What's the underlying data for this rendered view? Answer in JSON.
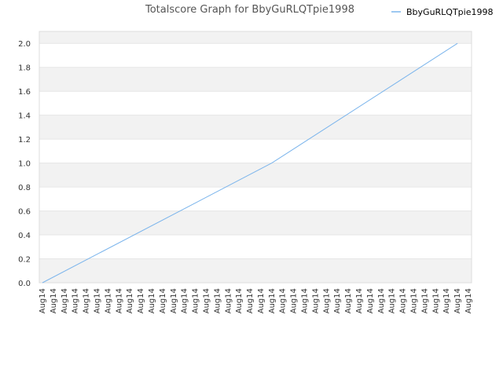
{
  "chart_data": {
    "type": "line",
    "title": "Totalscore Graph for BbyGuRLQTpie1998",
    "xlabel": "",
    "ylabel": "",
    "ylim": [
      0,
      2.1
    ],
    "y_ticks": [
      "0.0",
      "0.2",
      "0.4",
      "0.6",
      "0.8",
      "1.0",
      "1.2",
      "1.4",
      "1.6",
      "1.8",
      "2.0"
    ],
    "x_tick_labels": [
      "Aug14",
      "Aug14",
      "Aug14",
      "Aug14",
      "Aug14",
      "Aug14",
      "Aug14",
      "Aug14",
      "Aug14",
      "Aug14",
      "Aug14",
      "Aug14",
      "Aug14",
      "Aug14",
      "Aug14",
      "Aug14",
      "Aug14",
      "Aug14",
      "Aug14",
      "Aug14",
      "Aug14",
      "Aug14",
      "Aug14",
      "Aug14",
      "Aug14",
      "Aug14",
      "Aug14",
      "Aug14",
      "Aug14",
      "Aug14",
      "Aug14",
      "Aug14",
      "Aug14",
      "Aug14",
      "Aug14",
      "Aug14",
      "Aug14",
      "Aug14",
      "Aug14",
      "Aug14"
    ],
    "legend_position": "top-right",
    "grid": true,
    "band_colors": [
      "#f2f2f2",
      "#ffffff"
    ],
    "series": [
      {
        "name": "BbyGuRLQTpie1998",
        "color": "#7cb5ec",
        "x": [
          0,
          21,
          38
        ],
        "values": [
          0.0,
          1.0,
          2.0
        ]
      }
    ]
  }
}
